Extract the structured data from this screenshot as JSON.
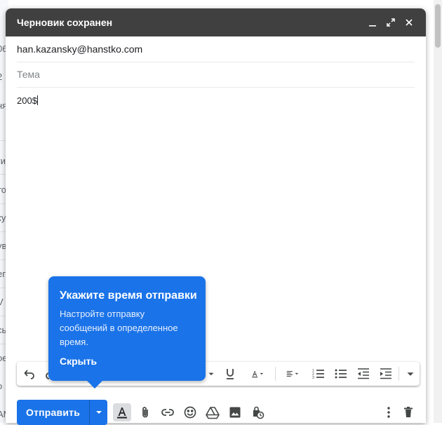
{
  "background_fragments": [
    "06",
    "2",
    "ня",
    "ги",
    "то",
    "ку",
    "ув",
    "ег",
    "V",
    "сь",
    "ое",
    "о",
    "AM"
  ],
  "compose": {
    "title": "Черновик сохранен",
    "to": "han.kazansky@hanstko.com",
    "subject_placeholder": "Тема",
    "body": "200$"
  },
  "callout": {
    "title": "Укажите время отправки",
    "text": "Настройте отправку сообщений в определенное время.",
    "dismiss": "Скрыть"
  },
  "bottom_bar": {
    "send_label": "Отправить"
  },
  "colors": {
    "title_bar": "#404040",
    "accent": "#1a73e8"
  }
}
